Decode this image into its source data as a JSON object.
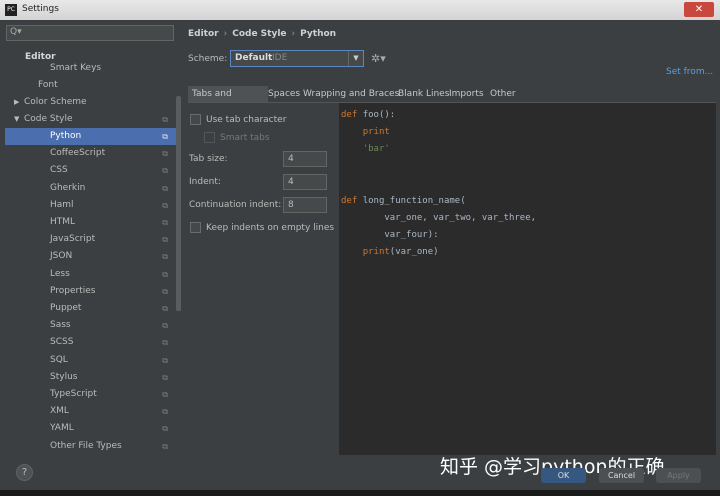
{
  "window": {
    "title": "Settings",
    "app_icon": "PC",
    "close": "✕"
  },
  "search": {
    "icon": "Q▾"
  },
  "tree": [
    {
      "label": "Editor",
      "bold": true
    },
    {
      "label": "Smart Keys"
    },
    {
      "label": "Font"
    },
    {
      "label": "Color Scheme",
      "arrow": "▶"
    },
    {
      "label": "Code Style",
      "arrow": "▼",
      "copy": true
    },
    {
      "label": "Python",
      "selected": true,
      "copy": true
    },
    {
      "label": "CoffeeScript",
      "copy": true
    },
    {
      "label": "CSS",
      "copy": true
    },
    {
      "label": "Gherkin",
      "copy": true
    },
    {
      "label": "Haml",
      "copy": true
    },
    {
      "label": "HTML",
      "copy": true
    },
    {
      "label": "JavaScript",
      "copy": true
    },
    {
      "label": "JSON",
      "copy": true
    },
    {
      "label": "Less",
      "copy": true
    },
    {
      "label": "Properties",
      "copy": true
    },
    {
      "label": "Puppet",
      "copy": true
    },
    {
      "label": "Sass",
      "copy": true
    },
    {
      "label": "SCSS",
      "copy": true
    },
    {
      "label": "SQL",
      "copy": true
    },
    {
      "label": "Stylus",
      "copy": true
    },
    {
      "label": "TypeScript",
      "copy": true
    },
    {
      "label": "XML",
      "copy": true
    },
    {
      "label": "YAML",
      "copy": true
    },
    {
      "label": "Other File Types",
      "copy": true
    }
  ],
  "breadcrumb": [
    "Editor",
    "Code Style",
    "Python"
  ],
  "breadcrumb_sep": "›",
  "scheme": {
    "label": "Scheme:",
    "value": "Default",
    "tag": "IDE",
    "caret": "▼",
    "gear": "✲▾"
  },
  "set_from": "Set from...",
  "tabs": [
    "Tabs and Indents",
    "Spaces",
    "Wrapping and Braces",
    "Blank Lines",
    "Imports",
    "Other"
  ],
  "options": {
    "use_tab": "Use tab character",
    "smart_tabs": "Smart tabs",
    "tab_size_label": "Tab size:",
    "tab_size": "4",
    "indent_label": "Indent:",
    "indent": "4",
    "cont_indent_label": "Continuation indent:",
    "cont_indent": "8",
    "keep_indents": "Keep indents on empty lines"
  },
  "code": [
    [
      {
        "t": "def ",
        "c": "kw"
      },
      {
        "t": "foo():"
      }
    ],
    [
      {
        "t": "    "
      },
      {
        "t": "print",
        "c": "kw"
      }
    ],
    [
      {
        "t": "    "
      },
      {
        "t": "'bar'",
        "c": "str"
      }
    ],
    [],
    [],
    [
      {
        "t": "def ",
        "c": "kw"
      },
      {
        "t": "long_function_name("
      }
    ],
    [
      {
        "t": "        var_one, var_two, var_three,"
      }
    ],
    [
      {
        "t": "        var_four):"
      }
    ],
    [
      {
        "t": "    "
      },
      {
        "t": "print",
        "c": "kw"
      },
      {
        "t": "(var_one)"
      }
    ]
  ],
  "help": "?",
  "buttons": {
    "ok": "OK",
    "cancel": "Cancel",
    "apply": "Apply"
  },
  "watermark": "知乎 @学习python的正确..."
}
